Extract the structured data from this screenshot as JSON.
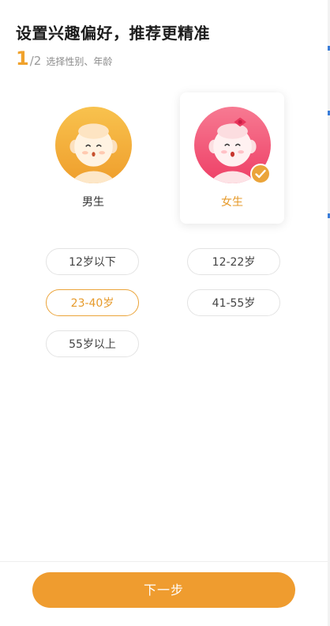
{
  "header": {
    "title": "设置兴趣偏好，推荐更精准",
    "step_current": "1",
    "step_total": "/2",
    "step_desc": "选择性别、年龄"
  },
  "gender": {
    "selected": "female",
    "options": [
      {
        "label": "男生",
        "selected": false
      },
      {
        "label": "女生",
        "selected": true
      }
    ]
  },
  "age": {
    "selected": "23-40岁",
    "options": [
      {
        "label": "12岁以下",
        "selected": false
      },
      {
        "label": "12-22岁",
        "selected": false
      },
      {
        "label": "23-40岁",
        "selected": true
      },
      {
        "label": "41-55岁",
        "selected": false
      },
      {
        "label": "55岁以上",
        "selected": false
      }
    ]
  },
  "footer": {
    "next_label": "下一步"
  },
  "colors": {
    "accent": "#ef9c2f",
    "accent_text": "#e69a2a",
    "male_avatar": "#f3b13b",
    "female_avatar": "#f2587a"
  },
  "icons": {
    "male_avatar": "male-monkey-avatar-icon",
    "female_avatar": "female-monkey-avatar-icon",
    "check": "check-circle-icon"
  }
}
